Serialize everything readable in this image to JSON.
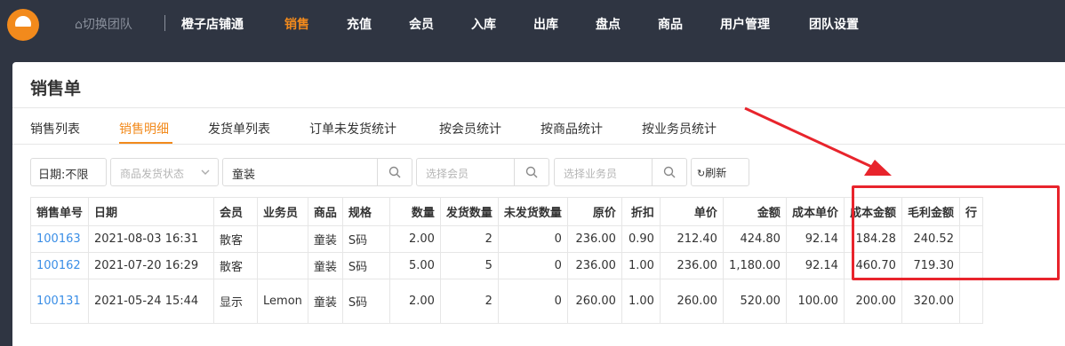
{
  "topbar": {
    "switch_team": "切换团队",
    "nav": [
      "橙子店铺通",
      "销售",
      "充值",
      "会员",
      "入库",
      "出库",
      "盘点",
      "商品",
      "用户管理",
      "团队设置"
    ],
    "active_index": 1
  },
  "page": {
    "title": "销售单",
    "tabs": [
      "销售列表",
      "销售明细",
      "发货单列表",
      "订单未发货统计",
      "按会员统计",
      "按商品统计",
      "按业务员统计"
    ],
    "active_tab_index": 1
  },
  "filters": {
    "date": "日期:不限",
    "ship_status_placeholder": "商品发货状态",
    "keyword_value": "童装",
    "member_placeholder": "选择会员",
    "salesperson_placeholder": "选择业务员",
    "refresh": "刷新"
  },
  "table": {
    "headers": [
      "销售单号",
      "日期",
      "会员",
      "业务员",
      "商品",
      "规格",
      "数量",
      "发货数量",
      "未发货数量",
      "原价",
      "折扣",
      "单价",
      "金额",
      "成本单价",
      "成本金额",
      "毛利金额",
      "行"
    ],
    "rows": [
      [
        "100163",
        "2021-08-03 16:31",
        "散客",
        "",
        "童装",
        "S码",
        "2.00",
        "2",
        "0",
        "236.00",
        "0.90",
        "212.40",
        "424.80",
        "92.14",
        "184.28",
        "240.52",
        ""
      ],
      [
        "100162",
        "2021-07-20 16:29",
        "散客",
        "",
        "童装",
        "S码",
        "5.00",
        "5",
        "0",
        "236.00",
        "1.00",
        "236.00",
        "1,180.00",
        "92.14",
        "460.70",
        "719.30",
        ""
      ],
      [
        "100131",
        "2021-05-24 15:44",
        "显示",
        "Lemon",
        "童装",
        "S码",
        "2.00",
        "2",
        "0",
        "260.00",
        "1.00",
        "260.00",
        "520.00",
        "100.00",
        "200.00",
        "320.00",
        ""
      ]
    ]
  },
  "colors": {
    "accent": "#f28a1c",
    "topbar": "#2f3542",
    "link": "#3a8ee6",
    "highlight": "#e8242c"
  }
}
